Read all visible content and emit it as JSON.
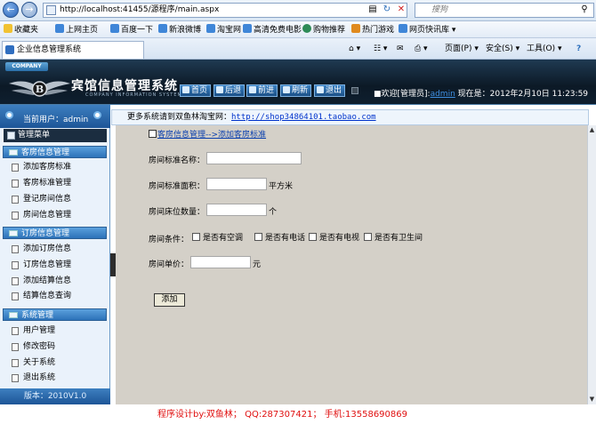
{
  "browser": {
    "url": "http://localhost:41455/源程序/main.aspx",
    "search_placeholder": "搜狗",
    "favorites_label": "收藏夹",
    "favorites": [
      "上网主页",
      "百度一下",
      "新浪微博",
      "淘宝网",
      "高清免费电影",
      "购物推荐",
      "热门游戏",
      "网页快讯库"
    ],
    "tab_title": "企业信息管理系统",
    "commands": [
      "页面(P)",
      "安全(S)",
      "工具(O)"
    ]
  },
  "header": {
    "company": "COMPANY",
    "title": "宾馆信息管理系统",
    "subtitle": "COMPANY INFORMATION SYSTEM",
    "buttons": [
      "首页",
      "后退",
      "前进",
      "刷新",
      "退出"
    ],
    "welcome_prefix": "欢迎[管理员]:",
    "welcome_user": "admin",
    "date_text": "现在是：2012年2月10日 11:23:59"
  },
  "sidebar": {
    "current_user": "当前用户：admin",
    "menu_title": "管理菜单",
    "groups": [
      {
        "title": "客房信息管理",
        "items": [
          "添加客房标准",
          "客房标准管理",
          "登记房间信息",
          "房间信息管理"
        ]
      },
      {
        "title": "订房信息管理",
        "items": [
          "添加订房信息",
          "订房信息管理",
          "添加结算信息",
          "结算信息查询"
        ]
      },
      {
        "title": "系统管理",
        "items": [
          "用户管理",
          "修改密码",
          "关于系统",
          "退出系统"
        ]
      }
    ],
    "version": "版本：2010V1.0"
  },
  "notice": {
    "text": "更多系统请到双鱼林淘宝网：",
    "link": "http://shop34864101.taobao.com"
  },
  "form": {
    "breadcrumb": "客房信息管理-->添加客房标准",
    "fields": [
      {
        "label": "房间标准名称：",
        "value": "",
        "unit": ""
      },
      {
        "label": "房间标准面积：",
        "value": "",
        "unit": "平方米"
      },
      {
        "label": "房间床位数量：",
        "value": "",
        "unit": "个"
      }
    ],
    "conditions_label": "房间条件：",
    "conditions": [
      "是否有空调",
      "是否有电话",
      "是否有电视",
      "是否有卫生间"
    ],
    "price_label": "房间单价：",
    "price_value": "",
    "price_unit": "元",
    "submit_label": "添加"
  },
  "footer": {
    "text": "程序设计by:双鱼林；  QQ:287307421；  手机:13558690869"
  },
  "colors": {
    "content_bg": "#d4d0c8",
    "sidebar_accent": "#2d72b8",
    "header_bg": "#0c1926",
    "footer_text": "#e01010"
  }
}
